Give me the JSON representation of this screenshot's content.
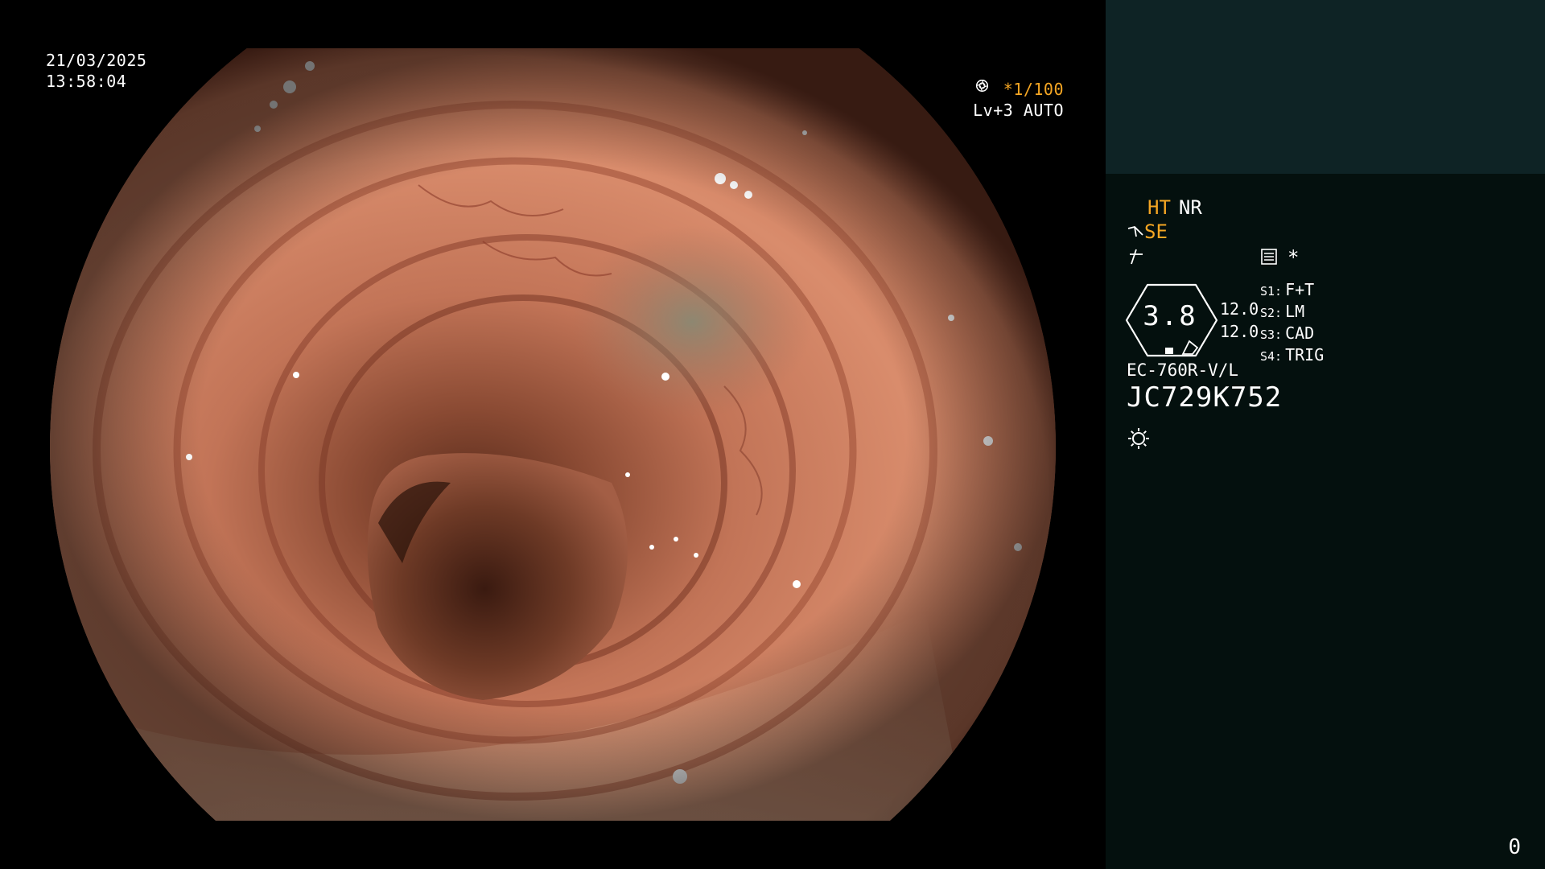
{
  "overlay": {
    "date": "21/03/2025",
    "time": "13:58:04",
    "shutter": "*1/100",
    "brightness": "Lv+3 AUTO"
  },
  "panel": {
    "ht": "HT",
    "nr": "NR",
    "se": "SE",
    "tip_diameter": "3.8",
    "mag_1": "12.0",
    "mag_2": "12.0",
    "switches": [
      {
        "key": "S1:",
        "value": "F+T"
      },
      {
        "key": "S2:",
        "value": "LM"
      },
      {
        "key": "S3:",
        "value": "CAD"
      },
      {
        "key": "S4:",
        "value": "TRIG"
      }
    ],
    "asterisk": "*",
    "model": "EC-760R-V/L",
    "serial": "JC729K752",
    "frame_count": "0"
  },
  "colors": {
    "accent_orange": "#f5a623",
    "panel_top": "#0e2325",
    "panel_bottom": "#04100e",
    "mucosa": "#c97a5c"
  },
  "icons": [
    "shutter-aperture-icon",
    "auto-iris-icon",
    "scope-connector-icon",
    "freeze-icon",
    "record-menu-icon",
    "light-source-icon"
  ]
}
